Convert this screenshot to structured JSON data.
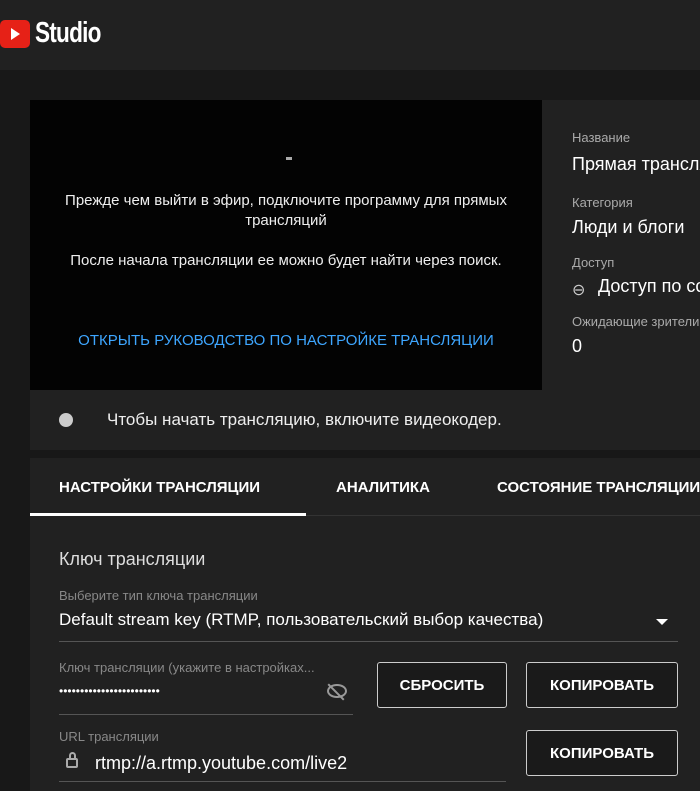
{
  "header": {
    "logo_text": "Studio"
  },
  "video": {
    "line1": "Прежде чем выйти в эфир, подключите программу для прямых трансляций",
    "line2": "После начала трансляции ее можно будет найти через поиск.",
    "guide_link": "ОТКРЫТЬ РУКОВОДСТВО ПО НАСТРОЙКЕ ТРАНСЛЯЦИИ"
  },
  "info": {
    "title_label": "Название",
    "title_value": "Прямая трансляция",
    "category_label": "Категория",
    "category_value": "Люди и блоги",
    "access_label": "Доступ",
    "access_value": "Доступ по ссылке",
    "waiting_label": "Ожидающие зрители",
    "waiting_value": "0"
  },
  "status": {
    "text": "Чтобы начать трансляцию, включите видеокодер."
  },
  "tabs": [
    {
      "label": "НАСТРОЙКИ ТРАНСЛЯЦИИ"
    },
    {
      "label": "АНАЛИТИКА"
    },
    {
      "label": "СОСТОЯНИЕ ТРАНСЛЯЦИИ"
    }
  ],
  "settings": {
    "section_title": "Ключ трансляции",
    "key_type_label": "Выберите тип ключа трансляции",
    "key_type_value": "Default stream key (RTMP, пользовательский выбор качества)",
    "key_label": "Ключ трансляции (укажите в настройках...",
    "key_value": "••••••••••••••••••••••••",
    "reset_button": "СБРОСИТЬ",
    "copy_button": "КОПИРОВАТЬ",
    "url_label": "URL трансляции",
    "url_value": "rtmp://a.rtmp.youtube.com/live2",
    "copy_url_button": "КОПИРОВАТЬ"
  }
}
